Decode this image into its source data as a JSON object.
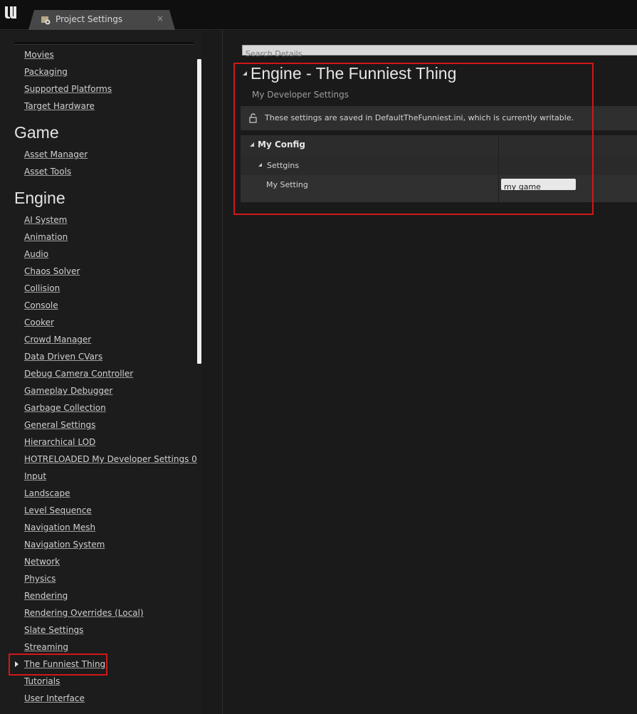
{
  "titlebar": {
    "tab_label": "Project Settings",
    "close_glyph": "×",
    "logo_icon": "unreal-engine-logo",
    "tab_icon": "project-settings-icon"
  },
  "sidebar": {
    "scroll_position_fraction": 0.09,
    "items_top": [
      "Movies",
      "Packaging",
      "Supported Platforms",
      "Target Hardware"
    ],
    "game_header": "Game",
    "game_items": [
      "Asset Manager",
      "Asset Tools"
    ],
    "engine_header": "Engine",
    "engine_items": [
      "AI System",
      "Animation",
      "Audio",
      "Chaos Solver",
      "Collision",
      "Console",
      "Cooker",
      "Crowd Manager",
      "Data Driven CVars",
      "Debug Camera Controller",
      "Gameplay Debugger",
      "Garbage Collection",
      "General Settings",
      "Hierarchical LOD",
      "HOTRELOADED My Developer Settings 0",
      "Input",
      "Landscape",
      "Level Sequence",
      "Navigation Mesh",
      "Navigation System",
      "Network",
      "Physics",
      "Rendering",
      "Rendering Overrides (Local)",
      "Slate Settings",
      "Streaming",
      "The Funniest Thing",
      "Tutorials",
      "User Interface"
    ],
    "selected_item": "The Funniest Thing"
  },
  "main": {
    "search_placeholder": "Search Details",
    "section_title": "Engine - The Funniest Thing",
    "section_subtitle": "My Developer Settings",
    "notice_text": "These settings are saved in DefaultTheFunniest.ini, which is currently writable.",
    "notice_icon": "unlocked-icon",
    "category_label": "My Config",
    "subcategory_label": "Settgins",
    "property_name": "My Setting",
    "property_value": "my game"
  },
  "colors": {
    "highlight": "#d01818",
    "background": "#1a1a1a",
    "panel": "#2c2c2c"
  }
}
